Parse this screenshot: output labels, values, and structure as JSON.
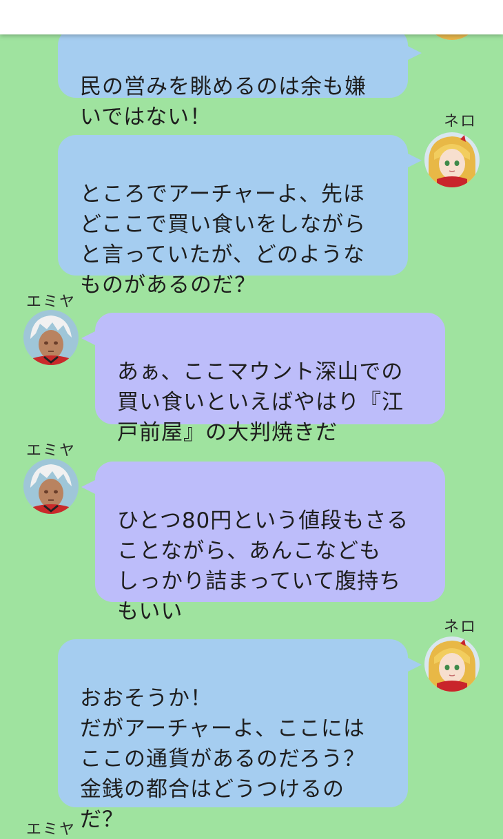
{
  "messages": [
    {
      "id": 0,
      "side": "right",
      "sender": "",
      "text": "民の営みを眺めるのは余も嫌\nいではない！"
    },
    {
      "id": 1,
      "side": "right",
      "sender": "ネロ",
      "text": "ところでアーチャーよ、先ほ\nどここで買い食いをしながら\nと言っていたが、どのような\nものがあるのだ？"
    },
    {
      "id": 2,
      "side": "left",
      "sender": "エミヤ",
      "text": "あぁ、ここマウント深山での\n買い食いといえばやはり『江\n戸前屋』の大判焼きだ"
    },
    {
      "id": 3,
      "side": "left",
      "sender": "エミヤ",
      "text": "ひとつ80円という値段もさる\nことながら、あんこなども\nしっかり詰まっていて腹持ち\nもいい"
    },
    {
      "id": 4,
      "side": "right",
      "sender": "ネロ",
      "text": "おおそうか！\nだがアーチャーよ、ここには\nここの通貨があるのだろう？\n金銭の都合はどうつけるの\nだ？"
    },
    {
      "id": 5,
      "side": "left",
      "sender": "エミヤ",
      "text": ""
    }
  ],
  "avatars": {
    "nero": "nero-avatar",
    "emiya": "emiya-avatar"
  },
  "colors": {
    "background": "#9fe39f",
    "right_bubble": "#a5cdf0",
    "left_bubble": "#bdbdfa"
  }
}
